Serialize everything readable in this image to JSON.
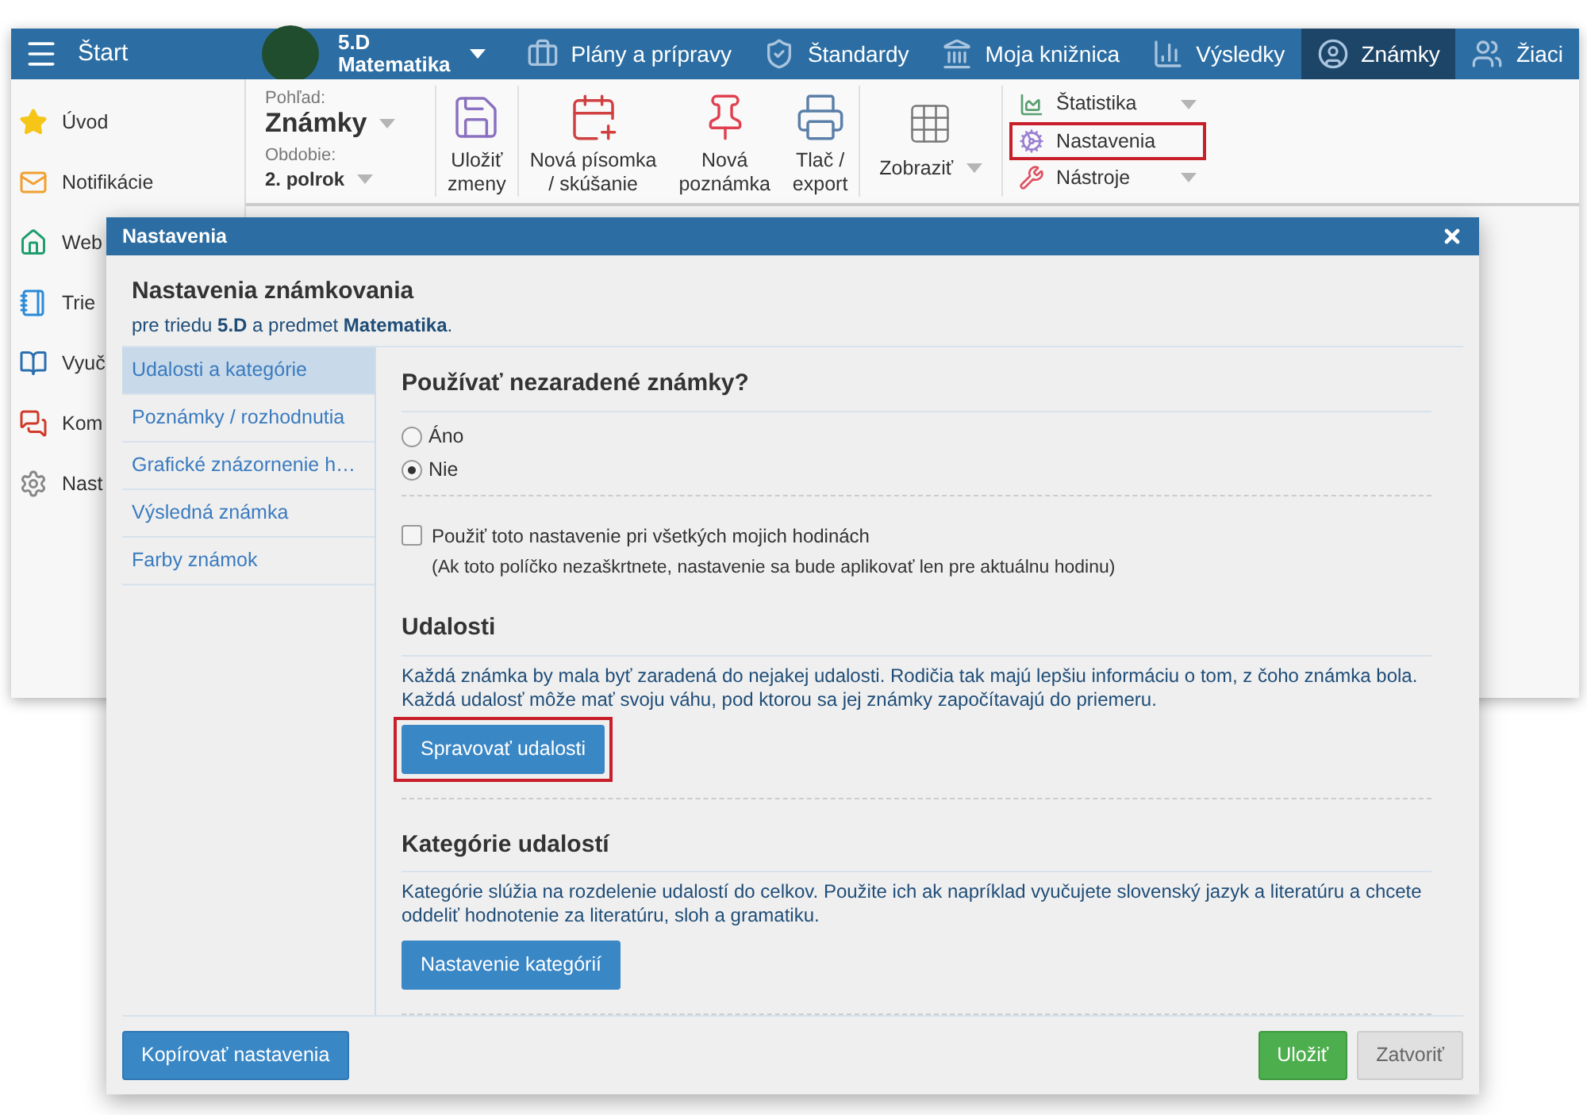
{
  "app": {
    "menu_label": "Štart",
    "class_selector": {
      "class": "5.D",
      "subject": "Matematika"
    },
    "nav": [
      {
        "label": "Plány a prípravy",
        "selected": false
      },
      {
        "label": "Štandardy",
        "selected": false
      },
      {
        "label": "Moja knižnica",
        "selected": false
      },
      {
        "label": "Výsledky",
        "selected": false
      },
      {
        "label": "Známky",
        "selected": true
      },
      {
        "label": "Žiaci",
        "selected": false
      }
    ],
    "sidebar": [
      {
        "label": "Úvod"
      },
      {
        "label": "Notifikácie"
      },
      {
        "label": "Web"
      },
      {
        "label": "Trie"
      },
      {
        "label": "Vyuč"
      },
      {
        "label": "Kom"
      },
      {
        "label": "Nast"
      }
    ],
    "ribbon": {
      "view_label": "Pohľad:",
      "view_value": "Známky",
      "period_label": "Obdobie:",
      "period_value": "2. polrok",
      "buttons": [
        {
          "label": "Uložiť\nzmeny"
        },
        {
          "label": "Nová písomka\n/ skúšanie"
        },
        {
          "label": "Nová\npoznámka"
        },
        {
          "label": "Tlač /\nexport"
        }
      ],
      "display": {
        "label": "Zobraziť"
      },
      "menu": [
        {
          "label": "Štatistika",
          "dropdown": true,
          "highlighted": false
        },
        {
          "label": "Nastavenia",
          "dropdown": false,
          "highlighted": true
        },
        {
          "label": "Nástroje",
          "dropdown": true,
          "highlighted": false
        }
      ]
    }
  },
  "dialog": {
    "title": "Nastavenia",
    "heading": "Nastavenia známkovania",
    "subtitle": "pre triedu **5.D** a predmet **Matematika**.",
    "tabs": [
      {
        "label": "Udalosti a kategórie",
        "selected": true
      },
      {
        "label": "Poznámky / rozhodnutia",
        "selected": false
      },
      {
        "label": "Grafické znázornenie h…",
        "selected": false
      },
      {
        "label": "Výsledná známka",
        "selected": false
      },
      {
        "label": "Farby známok",
        "selected": false
      }
    ],
    "question": {
      "title": "Používať nezaradené známky?",
      "options": [
        {
          "label": "Áno",
          "selected": false
        },
        {
          "label": "Nie",
          "selected": true
        }
      ]
    },
    "apply_all": {
      "label": "Použiť toto nastavenie pri všetkých mojich hodinách",
      "checked": false,
      "note": "(Ak toto políčko nezaškrtnete, nastavenie sa bude aplikovať len pre aktuálnu hodinu)"
    },
    "sections": [
      {
        "title": "Udalosti",
        "text": "Každá známka by mala byť zaradená do nejakej udalosti. Rodičia tak majú lepšiu informáciu o tom, z čoho známka bola. Každá udalosť môže mať svoju váhu, pod ktorou sa jej známky započítavajú do priemeru.",
        "button": "Spravovať udalosti",
        "highlighted": true
      },
      {
        "title": "Kategórie udalostí",
        "text": "Kategórie slúžia na rozdelenie udalostí do celkov. Použite ich ak napríklad vyučujete slovenský jazyk a literatúru a chcete oddeliť hodnotenie za literatúru, sloh a gramatiku.",
        "button": "Nastavenie kategórií",
        "highlighted": false
      }
    ],
    "footer_buttons": [
      {
        "label": "Kopírovať nastavenia",
        "kind": "primary"
      },
      {
        "label": "Uložiť",
        "kind": "success"
      },
      {
        "label": "Zatvoriť",
        "kind": "default"
      }
    ]
  }
}
